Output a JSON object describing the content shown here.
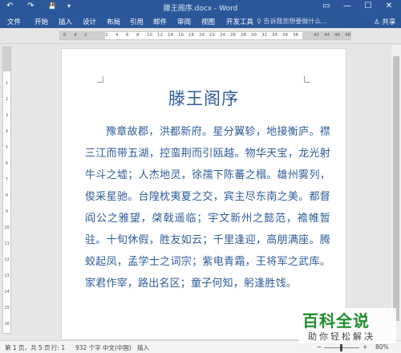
{
  "titlebar": {
    "document_title": "滕王阁序.docx - Word",
    "undo": "↶",
    "redo": "↷",
    "save": "💾",
    "customize": "▾",
    "ribbon_options": "▭",
    "minimize": "—",
    "restore": "☐",
    "close": "✕"
  },
  "ribbon": {
    "tabs": [
      "文件",
      "开始",
      "插入",
      "设计",
      "布局",
      "引用",
      "邮件",
      "审阅",
      "视图",
      "开发工具"
    ],
    "tell_me": "♀ 告诉我您想要做什么...",
    "share": "♙ 共享"
  },
  "ruler": {
    "ticks": [
      "6",
      "4",
      "2",
      "",
      "2",
      "4",
      "6",
      "8",
      "10",
      "12",
      "14",
      "16",
      "18",
      "20",
      "22",
      "24",
      "26",
      "28",
      "30",
      "32",
      "34",
      "36",
      "38",
      "",
      "42",
      "44",
      "46",
      "48"
    ]
  },
  "vruler": {
    "ticks": [
      "1",
      "2",
      "3",
      "4",
      "5",
      "6",
      "7",
      "8",
      "9",
      "10",
      "11",
      "12",
      "13",
      "14",
      "15",
      "16"
    ]
  },
  "document": {
    "heading": "滕王阁序",
    "body": "豫章故郡，洪都新府。星分翼轸，地接衡庐。襟三江而带五湖，控蛮荆而引瓯越。物华天宝，龙光射牛斗之墟；人杰地灵，徐孺下陈蕃之榻。雄州雾列，俊采星驰。台隍枕夷夏之交，宾主尽东南之美。都督阎公之雅望，棨戟遥临；宇文新州之懿范，襜帷暂驻。十旬休假，胜友如云；千里逢迎，高朋满座。腾蛟起凤，孟学士之词宗；紫电青霜，王将军之武库。家君作宰，路出名区；童子何知，躬逢胜饯。"
  },
  "statusbar": {
    "page": "第 1 页，共 5 页",
    "row": "行: 1",
    "words": "932 个字",
    "language": "中文(中国)",
    "insert_mode": "插入",
    "zoom_minus": "−",
    "zoom_plus": "+",
    "zoom": "80%"
  },
  "watermark": {
    "brand": "百科全说",
    "slogan": "助你轻松解决"
  },
  "colors": {
    "accent": "#2b579a",
    "text": "#2e5c99",
    "watermark": "#1d8e2a"
  }
}
